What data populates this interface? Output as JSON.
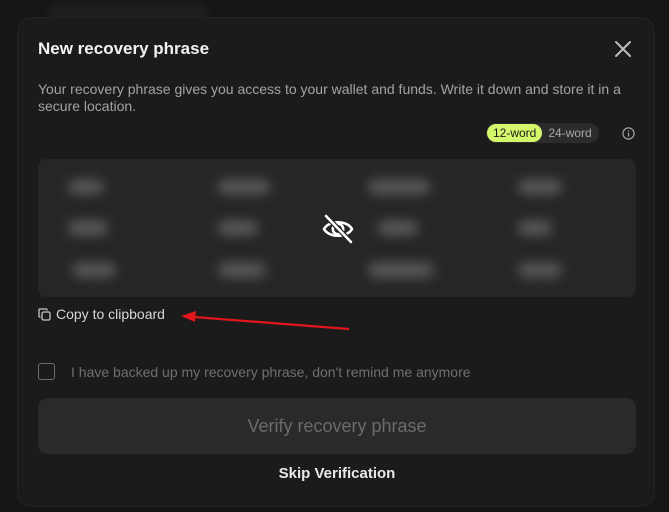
{
  "modal": {
    "title": "New recovery phrase",
    "description": "Your recovery phrase gives you access to your wallet and funds. Write it down and store it in a secure location.",
    "close_icon": "close-icon"
  },
  "word_toggle": {
    "options": [
      "12-word",
      "24-word"
    ],
    "selected": "12-word",
    "active_color": "#d4f76c",
    "info_icon": "info-icon"
  },
  "phrase": {
    "state": "hidden",
    "reveal_icon": "eye-off-icon"
  },
  "copy": {
    "label": "Copy to clipboard",
    "icon": "copy-icon"
  },
  "annotation": {
    "arrow_color": "#e0161a"
  },
  "confirm": {
    "label": "I have backed up my recovery phrase, don't remind me anymore",
    "checked": false
  },
  "actions": {
    "verify_label": "Verify recovery phrase",
    "verify_enabled": false,
    "skip_label": "Skip Verification"
  }
}
